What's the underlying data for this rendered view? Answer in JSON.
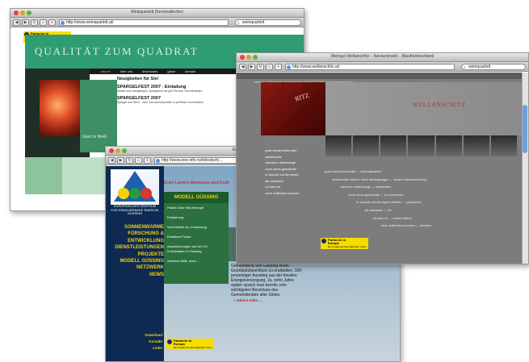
{
  "windows": {
    "weinquartett": {
      "title": "Weinquartett Donnerskirchen",
      "url": "http://www.weinquartett.at/",
      "search": "weinquartett",
      "slogan": "QUALITÄT ZUM QUADRAT",
      "nav": [
        "aktuell",
        "über uns",
        "downloads",
        "gäste",
        "kontakt"
      ],
      "heading": "Neuigkeiten für Sie!",
      "news_1_title": "SPARGELFEST 2007 - Einladung",
      "news_1_text": "Details zum diesjährigen Spargelfest als pdf File zum Herunterladen",
      "news_2_title": "SPARGELFEST 2007",
      "news_2_text": "Spargel und Wein - zwei Genussbotschafter in perfekter Kombination",
      "image_caption": "Ganz in Weiß"
    },
    "eebz": {
      "title": "Europäisches Zentrum",
      "url": "http://www.eee-info.net/deutsch/...",
      "red_title": "Erste Landes-Biomasse-und-Kraft",
      "logo_text": "EUROPÄISCHES ZENTRUM FÜR ERNEUERBARE ENERGIE GÜSSING",
      "menu": [
        "Sonnenwärme",
        "Forschung & Entwicklung",
        "Dienstleistungen",
        "Projekte",
        "Modell Güssing",
        "Netzwerk",
        "News"
      ],
      "bottom_menu": [
        "Download",
        "Kontakt",
        "Links"
      ],
      "modell": "MODELL GÜSSING",
      "sub_menu": [
        "Fakten über Windenergie",
        "Entstehung",
        "Vom Modell zur Umsetzung",
        "Erbaltene Preise",
        "Auszeichnungen auf der EU-Koordination in Güssing",
        "Ansehen Bitte, dann ..."
      ],
      "body_text": "Gemeinderat von Güssing einen Grundsatzbeschluss zu erarbeiten. 100-prozentiger Ausstieg aus der fossilen Energieversorgung. Ja, zehn Jahre später sprach man bereits vom wichtigsten Beschluss des Gemeinderates aller Zeiten.",
      "more_link": "» nähere Infos ..."
    },
    "wellanschitz": {
      "title": "Weingut Wellanschitz – Neckenmarkt – Blaufränkischland",
      "url": "http://www.wellanschitz.at/",
      "search": "weinquartett",
      "header_line": "weinbau | wellanschitz | Neckenmarkt | Tel 02610/42302 | info@wellanschitz.at",
      "red_text": "RITZ",
      "brand": "WELLANSCHITZ",
      "menu": [
        "guter tropfen/informativ",
        "wellanschitz",
        "zahlreich: rebenhänge",
        "neue servis geschichte",
        "in zukunft und die regeln",
        "die weinkarte",
        "rot werk rot",
        "neue zeitfenster kommen"
      ],
      "sitemap": [
        "guter tropfen/informativ → informativgleich",
        "wellanschitz weinen: reine übertragungen → unsere Interessenterung",
        "zahlreich: rebenhänge → übersichten",
        "neue servis geschichte → es zusehends",
        "in zukunft und die regeln erhalten → geschichte",
        "die weinkarte → ein",
        "rot werk rot → unsere Weine",
        "neue zeitfenster kommen → rotweine"
      ]
    }
  },
  "badges": {
    "line1": "Partnerin in",
    "line2": "Europa",
    "tag": "Ein Projekt der Europäischen Union"
  },
  "colors": {
    "weinquartett_green": "#2e9d72",
    "eebz_yellow": "#f5d100",
    "wellanschitz_red": "#b8282a"
  }
}
